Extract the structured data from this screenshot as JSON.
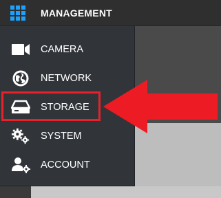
{
  "header": {
    "title": "MANAGEMENT",
    "icon": "grid-icon"
  },
  "menu": {
    "items": [
      {
        "label": "CAMERA",
        "icon": "camera-icon"
      },
      {
        "label": "NETWORK",
        "icon": "network-globe-icon"
      },
      {
        "label": "STORAGE",
        "icon": "storage-drive-icon",
        "highlighted": true
      },
      {
        "label": "SYSTEM",
        "icon": "gears-icon"
      },
      {
        "label": "ACCOUNT",
        "icon": "user-gear-icon"
      }
    ]
  },
  "colors": {
    "accent": "#1ea0ff",
    "menu_background": "#31353a",
    "topbar_background": "#2f2f2f",
    "highlight": "#e8212b"
  }
}
